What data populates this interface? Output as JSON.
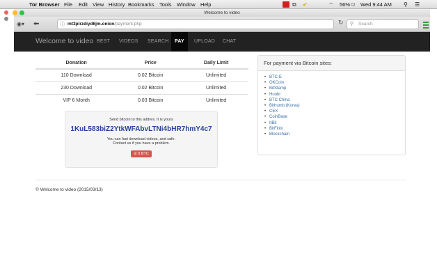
{
  "menubar": {
    "app": "Tor Browser",
    "items": [
      "File",
      "Edit",
      "View",
      "History",
      "Bookmarks",
      "Tools",
      "Window",
      "Help"
    ],
    "battery": "56%",
    "clock": "Wed 9:44 AM"
  },
  "window": {
    "title": "Welcome to video"
  },
  "toolbar": {
    "url_host": "mt3plrzdiyd6jm.onion",
    "url_path": "/payment.php",
    "search_placeholder": "Search"
  },
  "nav": {
    "brand": "Welcome to video",
    "links": [
      "BEST",
      "VIDEOS",
      "SEARCH",
      "PAY",
      "UPLOAD",
      "CHAT"
    ],
    "active": "PAY"
  },
  "table": {
    "headers": [
      "Donation",
      "Price",
      "Daily Limit"
    ],
    "rows": [
      [
        "110 Download",
        "0.02 Bitcoin",
        "Unlimited"
      ],
      [
        "230 Download",
        "0.02 Bitcoin",
        "Unlimited"
      ],
      [
        "VIP 6 Month",
        "0.03 Bitcoin",
        "Unlimited"
      ]
    ]
  },
  "payment": {
    "intro": "Send bitcoin to this addres. It is yours",
    "address": "1KuL583biZ2YtkWFAbvLTNi4bHR7hmY4c7",
    "note1": "You can fast download videos, and safe.",
    "note2": "Contact us if you have a problem.",
    "button": "0 BTC"
  },
  "sites": {
    "heading": "For payment via Bitcoin sites:",
    "items": [
      "BTC-E",
      "OKCoin",
      "BitStamp",
      "Houbi",
      "BTC China",
      "Bithumb (Korea)",
      "CEX",
      "CoinBase",
      "ItBit",
      "BitFinix",
      "Blockchain"
    ]
  },
  "footer": {
    "text": "© Welcome to video (2015/03/13)"
  },
  "colors": {
    "navbar": "#222222",
    "address": "#26409a",
    "button": "#d9534f",
    "link": "#3a6ea5"
  }
}
